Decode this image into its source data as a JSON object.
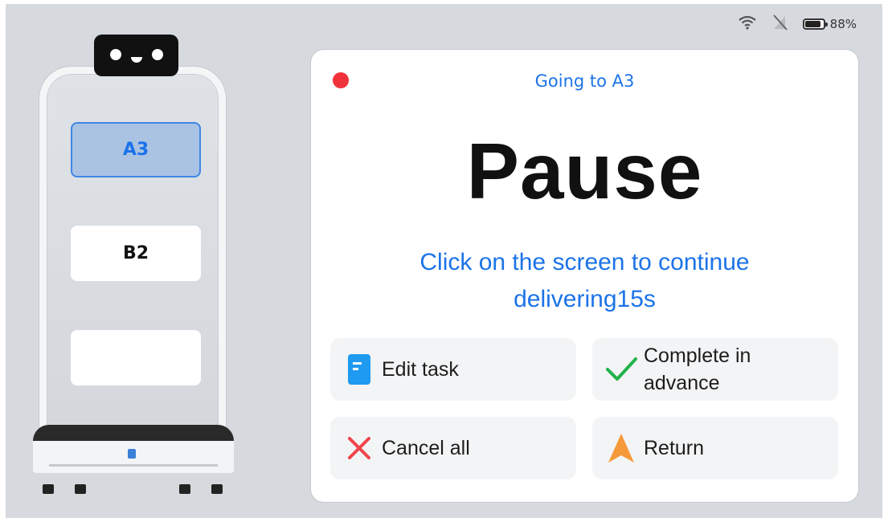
{
  "status_bar": {
    "battery_text": "88%",
    "battery_level": 0.88
  },
  "robot": {
    "trays": [
      {
        "label": "A3",
        "active": true
      },
      {
        "label": "B2",
        "active": false
      },
      {
        "label": "",
        "active": false
      }
    ]
  },
  "task_card": {
    "destination_text": "Going to A3",
    "state_title": "Pause",
    "hint_line1": "Click on the screen to continue",
    "hint_line2": "delivering15s",
    "buttons": {
      "edit": "Edit task",
      "complete_line1": "Complete in",
      "complete_line2": "advance",
      "cancel": "Cancel all",
      "return": "Return"
    }
  },
  "colors": {
    "accent": "#1c73e8",
    "record_dot": "#f0323a",
    "cancel": "#f0444b",
    "complete": "#22b24c",
    "return": "#f59a3a",
    "edit": "#1e9af0"
  },
  "icons": {
    "wifi": "wifi-icon",
    "signal": "no-signal-icon",
    "battery": "battery-icon",
    "edit": "edit-document-icon",
    "complete": "checkmark-icon",
    "cancel": "close-x-icon",
    "return": "navigation-arrow-icon"
  }
}
